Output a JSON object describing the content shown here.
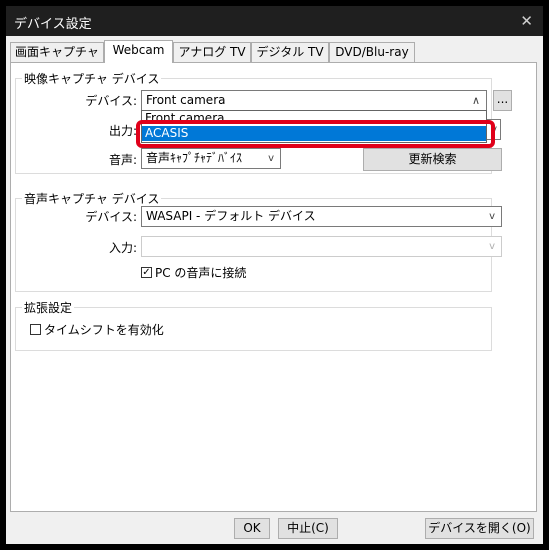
{
  "window": {
    "title": "デバイス設定",
    "close_glyph": "✕"
  },
  "tabs": [
    {
      "label": "画面キャプチャ"
    },
    {
      "label": "Webcam"
    },
    {
      "label": "アナログ TV"
    },
    {
      "label": "デジタル TV"
    },
    {
      "label": "DVD/Blu-ray"
    }
  ],
  "video_group": {
    "title": "映像キャプチャ デバイス",
    "device_label": "デバイス:",
    "device_value": "Front camera",
    "browse_label": "...",
    "output_label": "出力:",
    "audio_label": "音声:",
    "audio_value": "音声ｷｬﾌﾟﾁｬﾃﾞﾊﾞｲｽ",
    "refresh_label": "更新検索",
    "dropdown_options": [
      "Front camera",
      "ACASIS"
    ],
    "dropdown_selected": "ACASIS"
  },
  "audio_group": {
    "title": "音声キャプチャ デバイス",
    "device_label": "デバイス:",
    "device_value": "WASAPI - デフォルト デバイス",
    "input_label": "入力:",
    "input_value": "",
    "pc_audio_label": "PC の音声に接続",
    "pc_audio_checked": true
  },
  "ext_group": {
    "title": "拡張設定",
    "timeshift_label": "タイムシフトを有効化",
    "timeshift_checked": false
  },
  "footer": {
    "ok_label": "OK",
    "cancel_label": "中止(C)",
    "open_device_label": "デバイスを開く(O)"
  },
  "colors": {
    "highlight": "#e0001a",
    "selection": "#0078d7",
    "titlebar": "#1f1f1f"
  }
}
